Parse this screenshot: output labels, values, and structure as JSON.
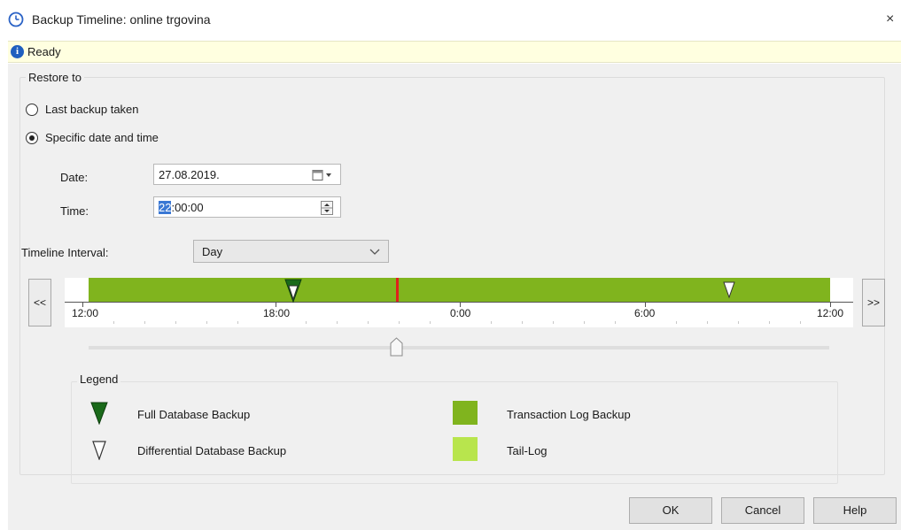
{
  "window": {
    "title": "Backup Timeline: online trgovina",
    "close_glyph": "×",
    "title_icon": "clock-icon"
  },
  "status": {
    "text": "Ready",
    "icon": "info-icon",
    "icon_glyph": "i"
  },
  "restore": {
    "group_label": "Restore to",
    "options": [
      {
        "label": "Last backup taken",
        "selected": false
      },
      {
        "label": "Specific date and time",
        "selected": true
      }
    ],
    "date_label": "Date:",
    "date_value": "27.08.2019.",
    "time_label": "Time:",
    "time_hour": "22",
    "time_rest": ":00:00"
  },
  "timeline": {
    "interval_label": "Timeline Interval:",
    "interval_value": "Day",
    "prev_label": "<<",
    "next_label": ">>",
    "tick_labels": [
      "12:00",
      "18:00",
      "0:00",
      "6:00",
      "12:00"
    ],
    "colors": {
      "transaction_log": "#80b41e",
      "tail_log": "#b8e54d",
      "full_backup": "#1a6a1a",
      "current_marker": "#e0201c",
      "differential": "#ffffff"
    }
  },
  "legend": {
    "title": "Legend",
    "items": [
      {
        "label": "Full Database Backup",
        "icon": "full-backup-triangle-icon"
      },
      {
        "label": "Transaction Log Backup",
        "icon": "transaction-log-swatch"
      },
      {
        "label": "Differential Database Backup",
        "icon": "differential-backup-triangle-icon"
      },
      {
        "label": "Tail-Log",
        "icon": "tail-log-swatch"
      }
    ]
  },
  "buttons": {
    "ok": "OK",
    "cancel": "Cancel",
    "help": "Help"
  }
}
